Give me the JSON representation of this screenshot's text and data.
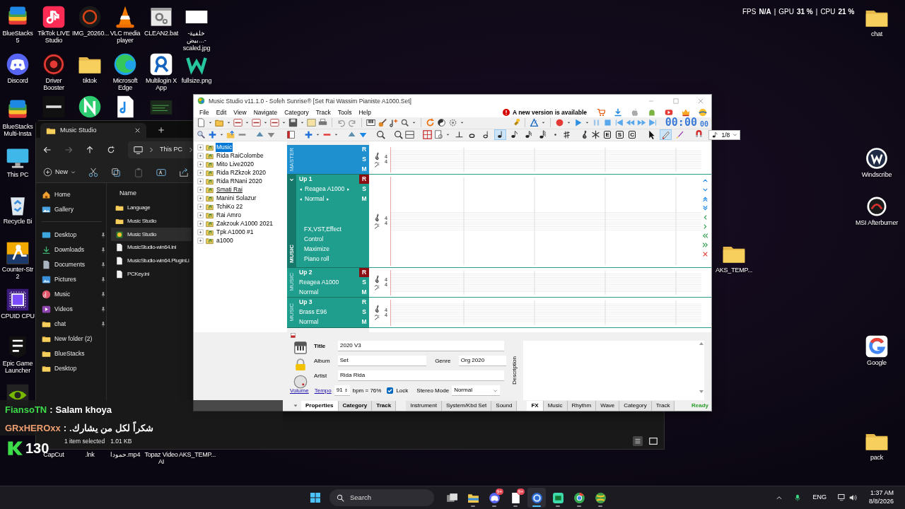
{
  "overlay_stats": [
    {
      "label": "FPS",
      "value": "N/A"
    },
    {
      "separator": "|",
      "label": "GPU",
      "value": "31 %"
    },
    {
      "separator": "|",
      "label": "CPU",
      "value": "21 %"
    }
  ],
  "desktop": {
    "top_rows": [
      [
        {
          "label": "BlueStacks 5",
          "kind": "bluestacks"
        },
        {
          "label": "TikTok LIVE Studio",
          "kind": "tiktok"
        },
        {
          "label": "IMG_20260...",
          "kind": "photo"
        },
        {
          "label": "VLC media player",
          "kind": "vlc"
        },
        {
          "label": "CLEAN2.bat",
          "kind": "bat"
        },
        {
          "label": "خلفية-بيض...-scaled.jpg",
          "kind": "blank"
        }
      ],
      [
        {
          "label": "Discord",
          "kind": "discord"
        },
        {
          "label": "Driver Booster",
          "kind": "booster"
        },
        {
          "label": "tiktok",
          "kind": "folder"
        },
        {
          "label": "Microsoft Edge",
          "kind": "edge"
        },
        {
          "label": "Multilogin X App",
          "kind": "multilogin"
        },
        {
          "label": "fullsize.png",
          "kind": "wlogo"
        }
      ]
    ],
    "left_column": [
      {
        "label": "BlueStacks Multi-Insta",
        "kind": "bluestacks"
      },
      {
        "label": "This PC",
        "kind": "monitor"
      },
      {
        "label": "Recycle Bi",
        "kind": "recycle"
      },
      {
        "label": "Counter-Str 2",
        "kind": "cs"
      },
      {
        "label": "CPUID CPU",
        "kind": "cpu"
      },
      {
        "label": "Epic Game Launcher",
        "kind": "epic"
      },
      {
        "kind": "nvidia"
      }
    ],
    "bottom_row": [
      {
        "label": "CapCut"
      },
      {
        "label": ".lnk"
      },
      {
        "label": "حمودا.mp4"
      },
      {
        "label": "Topaz Video AI"
      },
      {
        "label": "AKS_TEMP..."
      }
    ],
    "right_column": [
      {
        "label": "chat",
        "kind": "folder"
      },
      {
        "label": "Windscribe",
        "kind": "windscribe"
      },
      {
        "label": "MSI Afterburner",
        "kind": "msi"
      },
      {
        "label": "AKS_TEMP...",
        "kind": "folder"
      },
      {
        "label": "Google",
        "kind": "google"
      },
      {
        "label": "pack",
        "kind": "folder"
      }
    ]
  },
  "explorer": {
    "tab": "Music Studio",
    "address": "This PC",
    "new_button": "New",
    "sidebar": [
      {
        "label": "Home",
        "kind": "home",
        "pinned": false
      },
      {
        "label": "Gallery",
        "kind": "gallery",
        "pinned": false
      },
      {
        "label": "Desktop",
        "kind": "desktop",
        "pinned": true
      },
      {
        "label": "Downloads",
        "kind": "downloads",
        "pinned": true
      },
      {
        "label": "Documents",
        "kind": "documents",
        "pinned": true
      },
      {
        "label": "Pictures",
        "kind": "pictures",
        "pinned": true
      },
      {
        "label": "Music",
        "kind": "music",
        "pinned": true
      },
      {
        "label": "Videos",
        "kind": "videos",
        "pinned": true
      },
      {
        "label": "chat",
        "kind": "folder",
        "pinned": true
      },
      {
        "label": "New folder (2)",
        "kind": "folder",
        "pinned": false
      },
      {
        "label": "BlueStacks",
        "kind": "folder",
        "pinned": false
      },
      {
        "label": "Desktop",
        "kind": "folder",
        "pinned": false
      }
    ],
    "column_header": "Name",
    "files": [
      {
        "name": "Language",
        "kind": "folder",
        "selected": false
      },
      {
        "name": "Music Studio",
        "kind": "folder",
        "selected": false
      },
      {
        "name": "Music Studio",
        "kind": "app",
        "selected": true
      },
      {
        "name": "MusicStudio-win64.ini",
        "kind": "file",
        "selected": false
      },
      {
        "name": "MusicStudio-win64.PluginLi",
        "kind": "file",
        "selected": false
      },
      {
        "name": "PCKey.ini",
        "kind": "file",
        "selected": false
      }
    ],
    "status": "1 item selected",
    "size": "1.01 KB"
  },
  "app": {
    "title": "Music Studio v11.1.0 - Sofeh Sunrise®  [Set Rai Wassim Pianiste A1000.Set]",
    "menu": [
      "File",
      "Edit",
      "View",
      "Navigate",
      "Category",
      "Track",
      "Tools",
      "Help"
    ],
    "update_notice": "A new version is available",
    "clock": {
      "time": "00:00",
      "frames": "00"
    },
    "note_tools": [
      {
        "kind": "whole",
        "selected": false
      },
      {
        "kind": "half",
        "selected": false
      },
      {
        "kind": "quarter",
        "selected": true
      },
      {
        "kind": "eighth",
        "selected": false
      },
      {
        "kind": "sixteenth",
        "selected": false
      },
      {
        "kind": "thirtysecond",
        "selected": false
      }
    ],
    "mode_buttons": [
      "E",
      "S",
      "C"
    ],
    "edit_tools": [
      {
        "kind": "pointer",
        "selected": false
      },
      {
        "kind": "pencil",
        "selected": true
      },
      {
        "kind": "brush",
        "selected": false
      }
    ],
    "note_value": "1/8",
    "tree": [
      {
        "label": "Music",
        "selected": true,
        "hovered": false
      },
      {
        "label": "Rida RaiColombe",
        "selected": false,
        "hovered": false
      },
      {
        "label": "Mito Live2020",
        "selected": false,
        "hovered": false
      },
      {
        "label": "Rida RZkzok 2020",
        "selected": false,
        "hovered": false
      },
      {
        "label": "Rida RNani 2020",
        "selected": false,
        "hovered": false
      },
      {
        "label": "Smati Rai",
        "selected": false,
        "hovered": true
      },
      {
        "label": "Manini Solazur",
        "selected": false,
        "hovered": false
      },
      {
        "label": "TchiKo 22",
        "selected": false,
        "hovered": false
      },
      {
        "label": "Rai Amro",
        "selected": false,
        "hovered": false
      },
      {
        "label": "Zakzouk A1000 2021",
        "selected": false,
        "hovered": false
      },
      {
        "label": "Tpk A1000 #1",
        "selected": false,
        "hovered": false
      },
      {
        "label": "a1000",
        "selected": false,
        "hovered": false
      }
    ],
    "tracks": [
      {
        "kind": "master",
        "section": "MASTER",
        "buttons": [
          "R",
          "S",
          "M"
        ],
        "armed": false,
        "time_signature": [
          "4",
          "4"
        ]
      },
      {
        "kind": "music",
        "section": "MUSIC",
        "name": "Up 1",
        "instrument": "Reagea A1000",
        "mode": "Normal",
        "expanded": true,
        "armed": true,
        "buttons": [
          "R",
          "S",
          "M"
        ],
        "options": [
          "FX,VST,Effect",
          "Control",
          "Maximize",
          "Piano roll"
        ],
        "time_signature": [
          "4",
          "4"
        ]
      },
      {
        "kind": "music",
        "section": "MUSIC",
        "name": "Up 2",
        "instrument": "Reagea A1000",
        "mode": "Normal",
        "expanded": false,
        "armed": true,
        "buttons": [
          "R",
          "S",
          "M"
        ],
        "time_signature": [
          "4",
          "4"
        ]
      },
      {
        "kind": "music",
        "section": "MUSIC",
        "name": "Up 3",
        "instrument": "Brass E96",
        "mode": "Normal",
        "expanded": false,
        "armed": false,
        "buttons": [
          "R",
          "S",
          "M"
        ],
        "time_signature": [
          "4",
          "4"
        ]
      }
    ],
    "properties": {
      "title_label": "Title",
      "title": "2020 V3",
      "album_label": "Album",
      "album": "Set",
      "genre_label": "Genre",
      "genre": "Org 2020",
      "artist_label": "Artist",
      "artist": "Rida Rida",
      "volume_link": "Volume",
      "tempo_link": "Tempo",
      "tempo": "91",
      "bpm": "bpm = 76%",
      "lock_label": "Lock",
      "lock": true,
      "stereo_label": "Stereo Mode",
      "stereo": "Normal",
      "description_label": "Description"
    },
    "tab_groups": [
      {
        "bold": true,
        "tabs": [
          {
            "label": "Properties",
            "selected": true
          },
          {
            "label": "Category",
            "selected": false
          },
          {
            "label": "Track",
            "selected": false
          }
        ]
      },
      {
        "bold": false,
        "tabs": [
          {
            "label": "Instrument",
            "selected": false
          },
          {
            "label": "System/Kbd Set",
            "selected": false
          },
          {
            "label": "Sound",
            "selected": false
          }
        ]
      },
      {
        "bold": false,
        "tabs": [
          {
            "label": "FX",
            "selected": true
          },
          {
            "label": "Music",
            "selected": false
          },
          {
            "label": "Rhythm",
            "selected": false
          },
          {
            "label": "Wave",
            "selected": false
          },
          {
            "label": "Category",
            "selected": false
          },
          {
            "label": "Track",
            "selected": false
          }
        ]
      }
    ],
    "status": "Ready"
  },
  "chat_overlay": [
    {
      "user": "FiansoTN",
      "separator": ":",
      "message": "Salam khoya",
      "color": "#3ddc4a"
    },
    {
      "user": "GRxHEROxx",
      "separator": ":",
      "message": "شكراً لكل من يشارك.",
      "color": "#f0a070"
    }
  ],
  "counter": "130",
  "taskbar": {
    "search": "Search",
    "apps": [
      {
        "kind": "taskview",
        "active": false
      },
      {
        "kind": "explorer",
        "active": false
      },
      {
        "kind": "discord",
        "active": false,
        "badge": "9+"
      },
      {
        "kind": "file",
        "active": false,
        "badge": "9+"
      },
      {
        "kind": "browser",
        "active": true
      },
      {
        "kind": "chat",
        "active": false
      },
      {
        "kind": "chrome",
        "active": false
      },
      {
        "kind": "globe",
        "active": false
      }
    ],
    "language": "ENG",
    "time": "1:37 AM",
    "date": "8/8/2026"
  }
}
